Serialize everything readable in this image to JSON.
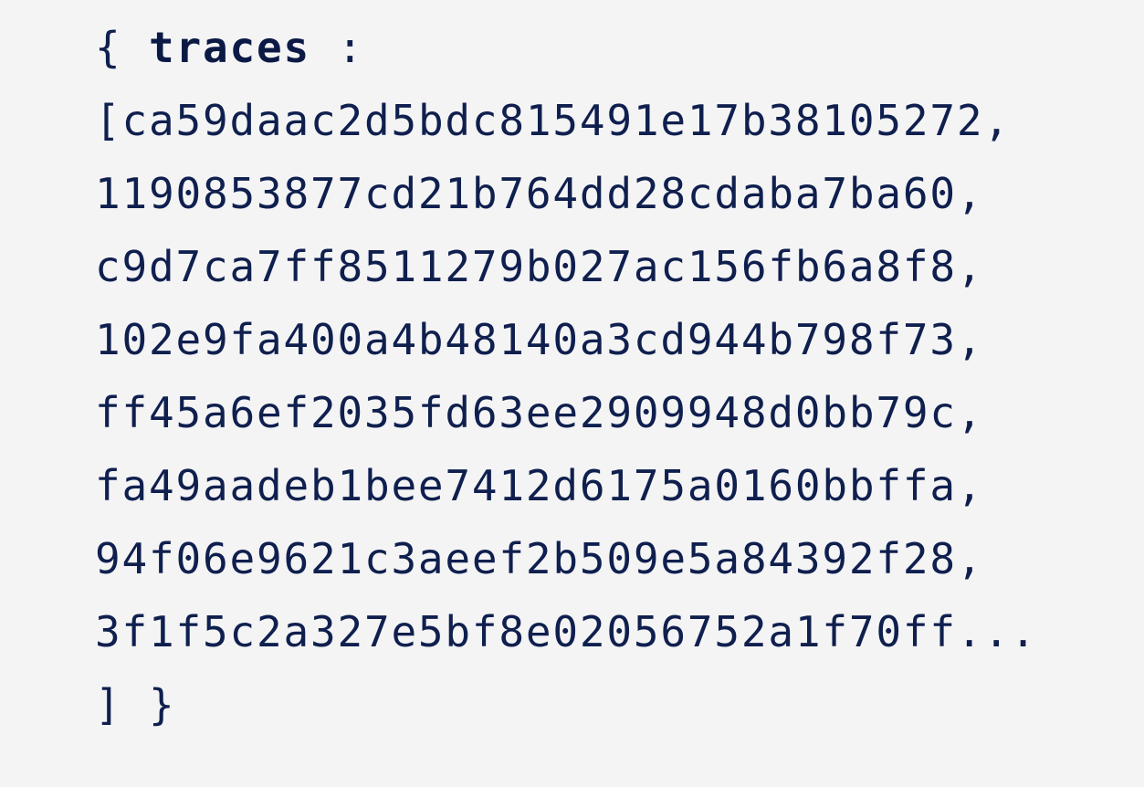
{
  "object": {
    "open_brace": "{",
    "key": "traces",
    "colon": ":",
    "open_bracket": "[",
    "traces": [
      "ca59daac2d5bdc815491e17b38105272,",
      "1190853877cd21b764dd28cdaba7ba60,",
      "c9d7ca7ff8511279b027ac156fb6a8f8,",
      "102e9fa400a4b48140a3cd944b798f73,",
      "ff45a6ef2035fd63ee2909948d0bb79c,",
      "fa49aadeb1bee7412d6175a0160bbffa,",
      "94f06e9621c3aeef2b509e5a84392f28,",
      "3f1f5c2a327e5bf8e02056752a1f70ff..."
    ],
    "close": "] }"
  },
  "colors": {
    "background": "#f4f4f5",
    "text": "#0f1f4e"
  }
}
